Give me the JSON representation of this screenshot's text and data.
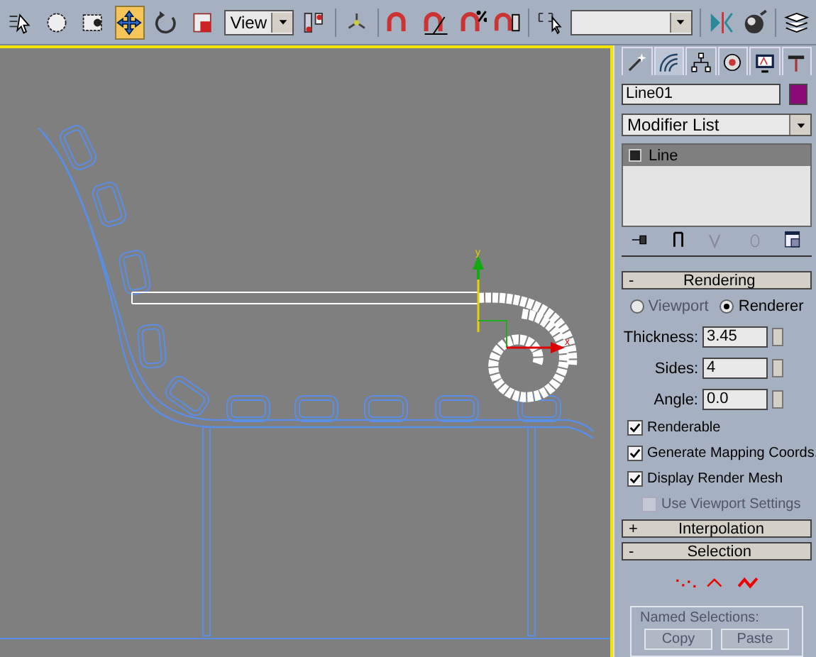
{
  "toolbar": {
    "tools": [
      {
        "selected": false
      },
      {
        "selected": false
      },
      {
        "selected": false
      },
      {
        "selected": true
      },
      {
        "selected": false
      },
      {
        "selected": false
      }
    ],
    "view_dropdown": {
      "value": "View"
    }
  },
  "viewport": {
    "gizmo": {
      "y_label": "y",
      "x_label": "x"
    }
  },
  "command_panel": {
    "tabs": [
      {
        "selected": false
      },
      {
        "selected": true
      },
      {
        "selected": false
      },
      {
        "selected": false
      },
      {
        "selected": false
      },
      {
        "selected": false
      }
    ],
    "object_name": {
      "value": "Line01",
      "color": "#8a0a78"
    },
    "modifier_list": {
      "value": "Modifier List"
    },
    "stack": [
      {
        "label": "Line",
        "selected": true
      }
    ],
    "rollouts": [
      {
        "kind": "rendering",
        "sign": "-",
        "title": "Rendering",
        "radios": [
          {
            "label": "Viewport",
            "selected": false,
            "disabled": true
          },
          {
            "label": "Renderer",
            "selected": true,
            "disabled": false
          }
        ],
        "spinners": [
          {
            "label": "Thickness:",
            "value": "3.45"
          },
          {
            "label": "Sides:",
            "value": "4"
          },
          {
            "label": "Angle:",
            "value": "0.0"
          }
        ],
        "checkboxes": [
          {
            "label": "Renderable",
            "checked": true,
            "disabled": false,
            "indented": false
          },
          {
            "label": "Generate Mapping Coords.",
            "checked": true,
            "disabled": false,
            "indented": false
          },
          {
            "label": "Display Render Mesh",
            "checked": true,
            "disabled": false,
            "indented": false
          },
          {
            "label": "Use Viewport Settings",
            "checked": false,
            "disabled": true,
            "indented": true
          }
        ]
      },
      {
        "kind": "collapsed",
        "sign": "+",
        "title": "Interpolation"
      },
      {
        "kind": "selection",
        "sign": "-",
        "title": "Selection",
        "named_selections": {
          "title": "Named Selections:",
          "buttons": [
            {
              "label": "Copy",
              "disabled": true
            },
            {
              "label": "Paste",
              "disabled": true
            }
          ]
        }
      }
    ]
  }
}
